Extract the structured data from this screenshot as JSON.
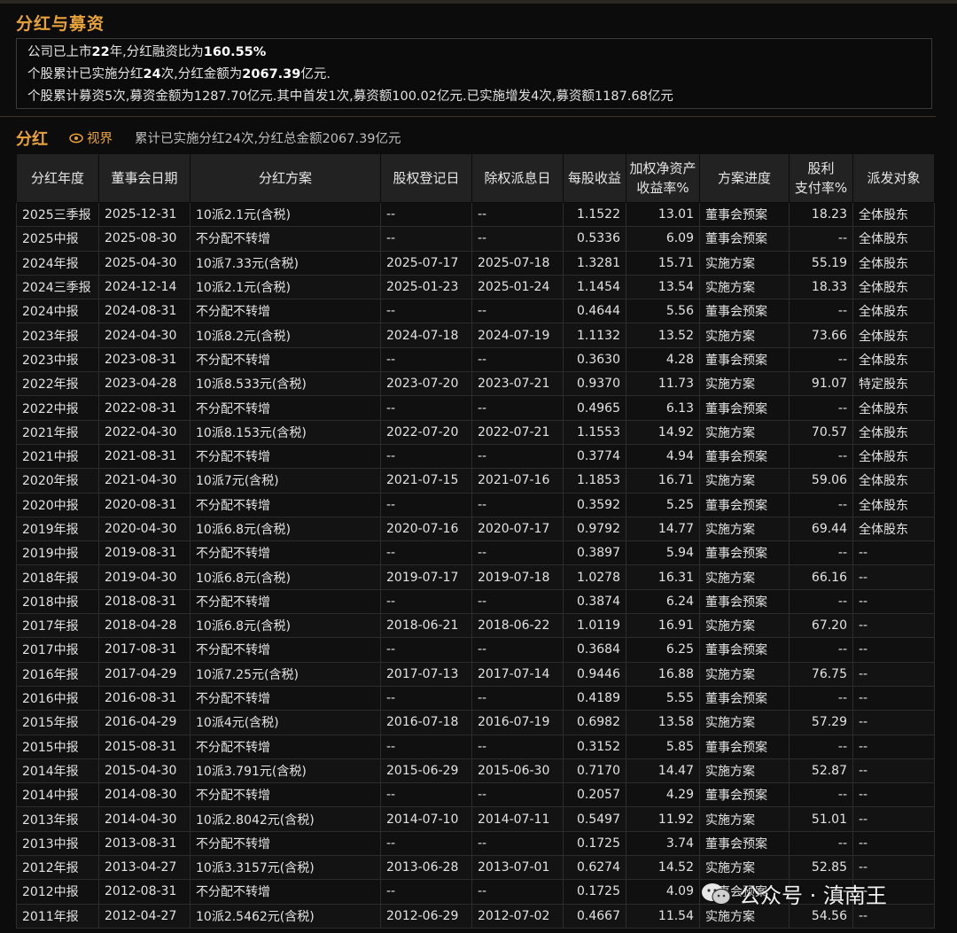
{
  "section_title": "分红与募资",
  "summary": {
    "line1_prefix": "公司已上市",
    "line1_years": "22",
    "line1_mid": "年,分红融资比为",
    "line1_ratio": "160.55%",
    "line2_prefix": "个股累计已实施分红",
    "line2_count": "24",
    "line2_mid": "次,分红金额为",
    "line2_amount": "2067.39",
    "line2_suffix": "亿元.",
    "line3": "个股累计募资5次,募资金额为1287.70亿元.其中首发1次,募资额100.02亿元.已实施增发4次,募资额1187.68亿元"
  },
  "fenhong": {
    "title": "分红",
    "view_label": "视界",
    "summary": "累计已实施分红24次,分红总金额2067.39亿元"
  },
  "table": {
    "headers": {
      "year": "分红年度",
      "board_date": "董事会日期",
      "plan": "分红方案",
      "reg_date": "股权登记日",
      "ex_date": "除权派息日",
      "eps": "每股收益",
      "roe_1": "加权净资产",
      "roe_2": "收益率%",
      "progress": "方案进度",
      "payout_1": "股利",
      "payout_2": "支付率%",
      "target": "派发对象"
    },
    "rows": [
      [
        "2025三季报",
        "2025-12-31",
        "10派2.1元(含税)",
        "--",
        "--",
        "1.1522",
        "13.01",
        "董事会预案",
        "18.23",
        "全体股东"
      ],
      [
        "2025中报",
        "2025-08-30",
        "不分配不转增",
        "--",
        "--",
        "0.5336",
        "6.09",
        "董事会预案",
        "--",
        "全体股东"
      ],
      [
        "2024年报",
        "2025-04-30",
        "10派7.33元(含税)",
        "2025-07-17",
        "2025-07-18",
        "1.3281",
        "15.71",
        "实施方案",
        "55.19",
        "全体股东"
      ],
      [
        "2024三季报",
        "2024-12-14",
        "10派2.1元(含税)",
        "2025-01-23",
        "2025-01-24",
        "1.1454",
        "13.54",
        "实施方案",
        "18.33",
        "全体股东"
      ],
      [
        "2024中报",
        "2024-08-31",
        "不分配不转增",
        "--",
        "--",
        "0.4644",
        "5.56",
        "董事会预案",
        "--",
        "全体股东"
      ],
      [
        "2023年报",
        "2024-04-30",
        "10派8.2元(含税)",
        "2024-07-18",
        "2024-07-19",
        "1.1132",
        "13.52",
        "实施方案",
        "73.66",
        "全体股东"
      ],
      [
        "2023中报",
        "2023-08-31",
        "不分配不转增",
        "--",
        "--",
        "0.3630",
        "4.28",
        "董事会预案",
        "--",
        "全体股东"
      ],
      [
        "2022年报",
        "2023-04-28",
        "10派8.533元(含税)",
        "2023-07-20",
        "2023-07-21",
        "0.9370",
        "11.73",
        "实施方案",
        "91.07",
        "特定股东"
      ],
      [
        "2022中报",
        "2022-08-31",
        "不分配不转增",
        "--",
        "--",
        "0.4965",
        "6.13",
        "董事会预案",
        "--",
        "全体股东"
      ],
      [
        "2021年报",
        "2022-04-30",
        "10派8.153元(含税)",
        "2022-07-20",
        "2022-07-21",
        "1.1553",
        "14.92",
        "实施方案",
        "70.57",
        "全体股东"
      ],
      [
        "2021中报",
        "2021-08-31",
        "不分配不转增",
        "--",
        "--",
        "0.3774",
        "4.94",
        "董事会预案",
        "--",
        "全体股东"
      ],
      [
        "2020年报",
        "2021-04-30",
        "10派7元(含税)",
        "2021-07-15",
        "2021-07-16",
        "1.1853",
        "16.71",
        "实施方案",
        "59.06",
        "全体股东"
      ],
      [
        "2020中报",
        "2020-08-31",
        "不分配不转增",
        "--",
        "--",
        "0.3592",
        "5.25",
        "董事会预案",
        "--",
        "全体股东"
      ],
      [
        "2019年报",
        "2020-04-30",
        "10派6.8元(含税)",
        "2020-07-16",
        "2020-07-17",
        "0.9792",
        "14.77",
        "实施方案",
        "69.44",
        "全体股东"
      ],
      [
        "2019中报",
        "2019-08-31",
        "不分配不转增",
        "--",
        "--",
        "0.3897",
        "5.94",
        "董事会预案",
        "--",
        "--"
      ],
      [
        "2018年报",
        "2019-04-30",
        "10派6.8元(含税)",
        "2019-07-17",
        "2019-07-18",
        "1.0278",
        "16.31",
        "实施方案",
        "66.16",
        "--"
      ],
      [
        "2018中报",
        "2018-08-31",
        "不分配不转增",
        "--",
        "--",
        "0.3874",
        "6.24",
        "董事会预案",
        "--",
        "--"
      ],
      [
        "2017年报",
        "2018-04-28",
        "10派6.8元(含税)",
        "2018-06-21",
        "2018-06-22",
        "1.0119",
        "16.91",
        "实施方案",
        "67.20",
        "--"
      ],
      [
        "2017中报",
        "2017-08-31",
        "不分配不转增",
        "--",
        "--",
        "0.3684",
        "6.25",
        "董事会预案",
        "--",
        "--"
      ],
      [
        "2016年报",
        "2017-04-29",
        "10派7.25元(含税)",
        "2017-07-13",
        "2017-07-14",
        "0.9446",
        "16.88",
        "实施方案",
        "76.75",
        "--"
      ],
      [
        "2016中报",
        "2016-08-31",
        "不分配不转增",
        "--",
        "--",
        "0.4189",
        "5.55",
        "董事会预案",
        "--",
        "--"
      ],
      [
        "2015年报",
        "2016-04-29",
        "10派4元(含税)",
        "2016-07-18",
        "2016-07-19",
        "0.6982",
        "13.58",
        "实施方案",
        "57.29",
        "--"
      ],
      [
        "2015中报",
        "2015-08-31",
        "不分配不转增",
        "--",
        "--",
        "0.3152",
        "5.85",
        "董事会预案",
        "--",
        "--"
      ],
      [
        "2014年报",
        "2015-04-30",
        "10派3.791元(含税)",
        "2015-06-29",
        "2015-06-30",
        "0.7170",
        "14.47",
        "实施方案",
        "52.87",
        "--"
      ],
      [
        "2014中报",
        "2014-08-30",
        "不分配不转增",
        "--",
        "--",
        "0.2057",
        "4.29",
        "董事会预案",
        "--",
        "--"
      ],
      [
        "2013年报",
        "2014-04-30",
        "10派2.8042元(含税)",
        "2014-07-10",
        "2014-07-11",
        "0.5497",
        "11.92",
        "实施方案",
        "51.01",
        "--"
      ],
      [
        "2013中报",
        "2013-08-31",
        "不分配不转增",
        "--",
        "--",
        "0.1725",
        "3.74",
        "董事会预案",
        "--",
        "--"
      ],
      [
        "2012年报",
        "2013-04-27",
        "10派3.3157元(含税)",
        "2013-06-28",
        "2013-07-01",
        "0.6274",
        "14.52",
        "实施方案",
        "52.85",
        "--"
      ],
      [
        "2012中报",
        "2012-08-31",
        "不分配不转增",
        "--",
        "--",
        "0.1725",
        "4.09",
        "董事会预案",
        "--",
        "--"
      ],
      [
        "2011年报",
        "2012-04-27",
        "10派2.5462元(含税)",
        "2012-06-29",
        "2012-07-02",
        "0.4667",
        "11.54",
        "实施方案",
        "54.56",
        "--"
      ]
    ]
  },
  "watermark": {
    "text": "公众号 · 滇南王",
    "icon": "wechat-icon"
  },
  "colors": {
    "accent": "#e8a23a",
    "background": "#0c0c0c",
    "header_bg": "#222222"
  }
}
